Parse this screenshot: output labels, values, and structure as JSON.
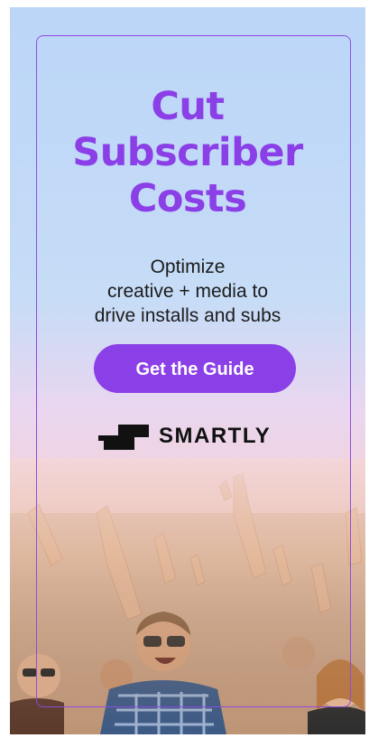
{
  "ad": {
    "headline_lines": [
      "Cut",
      "Subscriber",
      "Costs"
    ],
    "subhead_lines": [
      "Optimize",
      "creative + media to",
      "drive installs and subs"
    ],
    "cta_label": "Get the Guide",
    "brand_name": "SMARTLY",
    "brand_icon": "smartly-logo-icon"
  },
  "colors": {
    "accent": "#8b3fe6",
    "text": "#1c1c1c",
    "button_text": "#ffffff",
    "sky_top": "#bcd6f8"
  }
}
